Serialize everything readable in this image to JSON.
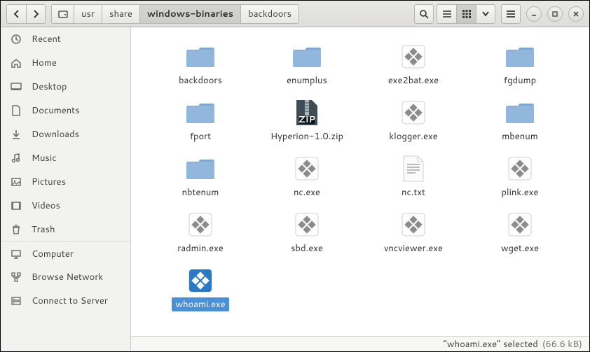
{
  "path": {
    "segments": [
      "usr",
      "share",
      "windows-binaries",
      "backdoors"
    ],
    "active_index": 2
  },
  "sidebar": {
    "items": [
      {
        "icon": "recent",
        "label": "Recent"
      },
      {
        "icon": "home",
        "label": "Home"
      },
      {
        "icon": "desktop",
        "label": "Desktop"
      },
      {
        "icon": "documents",
        "label": "Documents"
      },
      {
        "icon": "downloads",
        "label": "Downloads"
      },
      {
        "icon": "music",
        "label": "Music"
      },
      {
        "icon": "pictures",
        "label": "Pictures"
      },
      {
        "icon": "videos",
        "label": "Videos"
      },
      {
        "icon": "trash",
        "label": "Trash"
      },
      {
        "icon": "computer",
        "label": "Computer"
      },
      {
        "icon": "network",
        "label": "Browse Network"
      },
      {
        "icon": "server",
        "label": "Connect to Server"
      }
    ],
    "group_break_before": 9
  },
  "files": [
    {
      "name": "backdoors",
      "kind": "folder",
      "selected": false
    },
    {
      "name": "enumplus",
      "kind": "folder",
      "selected": false
    },
    {
      "name": "exe2bat.exe",
      "kind": "exe",
      "selected": false
    },
    {
      "name": "fgdump",
      "kind": "folder",
      "selected": false
    },
    {
      "name": "fport",
      "kind": "folder",
      "selected": false
    },
    {
      "name": "Hyperion-1.0.zip",
      "kind": "zip",
      "selected": false
    },
    {
      "name": "klogger.exe",
      "kind": "exe",
      "selected": false
    },
    {
      "name": "mbenum",
      "kind": "folder",
      "selected": false
    },
    {
      "name": "nbtenum",
      "kind": "folder",
      "selected": false
    },
    {
      "name": "nc.exe",
      "kind": "exe",
      "selected": false
    },
    {
      "name": "nc.txt",
      "kind": "txt",
      "selected": false
    },
    {
      "name": "plink.exe",
      "kind": "exe",
      "selected": false
    },
    {
      "name": "radmin.exe",
      "kind": "exe",
      "selected": false
    },
    {
      "name": "sbd.exe",
      "kind": "exe",
      "selected": false
    },
    {
      "name": "vncviewer.exe",
      "kind": "exe",
      "selected": false
    },
    {
      "name": "wget.exe",
      "kind": "exe",
      "selected": false
    },
    {
      "name": "whoami.exe",
      "kind": "exe",
      "selected": true
    }
  ],
  "status": {
    "text": "“whoami.exe” selected",
    "size": "(66.6 kB)"
  }
}
